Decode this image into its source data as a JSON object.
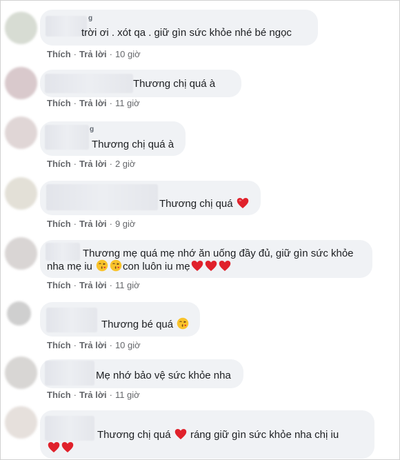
{
  "colors": {
    "bubble": "#f0f2f5",
    "meta": "#65676b",
    "heart": "#e0212b",
    "emoji_face": "#f9c32b"
  },
  "actions": {
    "like": "Thích",
    "reply": "Trả lời",
    "separator": "·"
  },
  "comments": [
    {
      "name_tail": "g",
      "text": "trời ơi . xót qa . giữ gìn sức khỏe nhé bé ngọc",
      "time": "10 giờ"
    },
    {
      "text": "Thương chị quá à",
      "time": "11 giờ"
    },
    {
      "name_tail": "g",
      "text": "Thương chị quá à",
      "time": "2 giờ"
    },
    {
      "text": "Thương chị quá",
      "time": "9 giờ"
    },
    {
      "text_line1": "Thương mẹ quá mẹ nhớ ăn uống đầy đủ, giữ gìn sức khỏe",
      "text_line2a": "nha mẹ iu",
      "text_line2b": "con luôn iu mẹ",
      "time": "11 giờ"
    },
    {
      "text": "Thương bé quá",
      "time": "10 giờ"
    },
    {
      "text": "Mẹ nhớ bảo vệ sức khỏe nha",
      "time": "11 giờ"
    },
    {
      "text_a": "Thương chị quá",
      "text_b": "ráng giữ gìn sức khỏe nha chị iu"
    }
  ]
}
